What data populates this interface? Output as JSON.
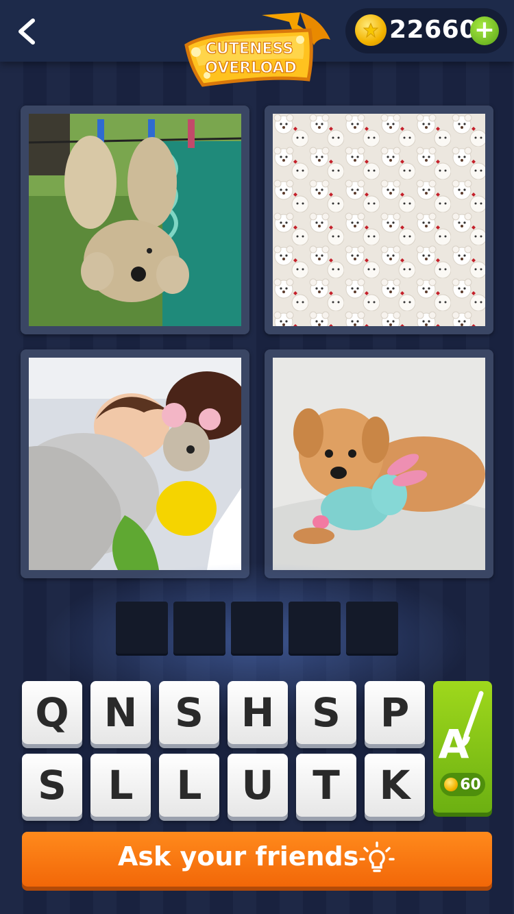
{
  "header": {
    "pack_title_line1": "CUTENESS",
    "pack_title_line2": "OVERLOAD",
    "coins": "22660",
    "back_icon": "chevron-left-icon",
    "coin_icon": "gold-coin-icon",
    "add_icon": "plus-icon"
  },
  "puzzle": {
    "photos": [
      {
        "subject": "teddy bear hanging on clothesline"
      },
      {
        "subject": "pile of white teddy bears"
      },
      {
        "subject": "sleeping child with stuffed toys"
      },
      {
        "subject": "puppy with plush bunny"
      }
    ],
    "answer_slots": [
      "",
      "",
      "",
      "",
      ""
    ]
  },
  "keyboard": {
    "row1": [
      "Q",
      "N",
      "S",
      "H",
      "S",
      "P"
    ],
    "row2": [
      "S",
      "L",
      "L",
      "U",
      "T",
      "K"
    ]
  },
  "hint": {
    "cost": "60",
    "icon": "letter-brush-icon"
  },
  "footer": {
    "ask_label": "Ask your friends",
    "ask_icon": "lightbulb-icon"
  },
  "colors": {
    "background": "#1a2442",
    "hint_green": "#8cc81a",
    "ask_orange": "#f57a10"
  }
}
